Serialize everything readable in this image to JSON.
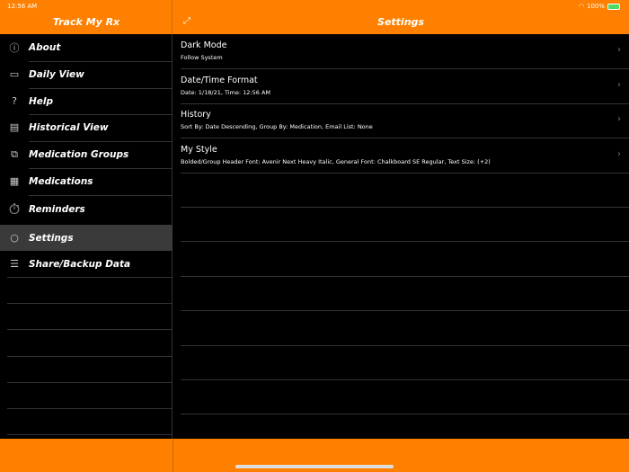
{
  "status": {
    "time": "12:56 AM",
    "battery": "100%"
  },
  "sidebar": {
    "title": "Track My Rx",
    "items": [
      {
        "label": "About",
        "icon": "info-icon"
      },
      {
        "label": "Daily View",
        "icon": "calendar-icon"
      },
      {
        "label": "Help",
        "icon": "question-icon"
      },
      {
        "label": "Historical View",
        "icon": "clipboard-icon"
      },
      {
        "label": "Medication Groups",
        "icon": "groups-icon"
      },
      {
        "label": "Medications",
        "icon": "grid-icon"
      },
      {
        "label": "Reminders",
        "icon": "stopwatch-icon"
      },
      {
        "label": "Settings",
        "icon": "gear-icon"
      },
      {
        "label": "Share/Backup Data",
        "icon": "share-icon"
      }
    ]
  },
  "main": {
    "title": "Settings",
    "rows": [
      {
        "title": "Dark Mode",
        "subtitle": "Follow System"
      },
      {
        "title": "Date/Time Format",
        "subtitle": "Date: 1/18/21, Time: 12:56 AM"
      },
      {
        "title": "History",
        "subtitle": "Sort By: Date Descending, Group By: Medication, Email List: None"
      },
      {
        "title": "My Style",
        "subtitle": "Bolded/Group Header Font: Avenir Next Heavy Italic, General Font: Chalkboard SE Regular, Text Size: (+2)"
      }
    ]
  },
  "colors": {
    "accent": "#FF8000",
    "selected": "#3a3a3a"
  }
}
